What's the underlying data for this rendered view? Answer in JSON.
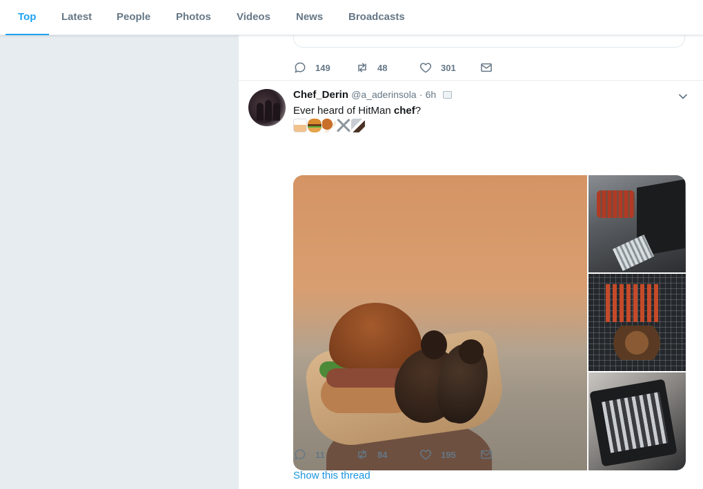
{
  "nav": {
    "tabs": [
      {
        "label": "Top",
        "active": true
      },
      {
        "label": "Latest"
      },
      {
        "label": "People"
      },
      {
        "label": "Photos"
      },
      {
        "label": "Videos"
      },
      {
        "label": "News"
      },
      {
        "label": "Broadcasts"
      }
    ]
  },
  "previous_tweet": {
    "replies": "149",
    "retweets": "48",
    "likes": "301"
  },
  "tweet": {
    "name": "Chef_Derin",
    "handle": "@a_aderinsola",
    "separator": "·",
    "time": "6h",
    "text_prefix": "Ever heard of HitMan ",
    "text_bold": "chef",
    "text_suffix": "?",
    "emoji_icons": [
      "cook-emoji",
      "burger-emoji",
      "chicken-leg-emoji",
      "crossed-swords-emoji",
      "knife-emoji"
    ],
    "replies": "11",
    "retweets": "84",
    "likes": "195",
    "show_thread": "Show this thread"
  },
  "colors": {
    "accent": "#1da1f2",
    "link": "#1b95e0",
    "muted": "#657786",
    "background": "#e6ecf0"
  }
}
